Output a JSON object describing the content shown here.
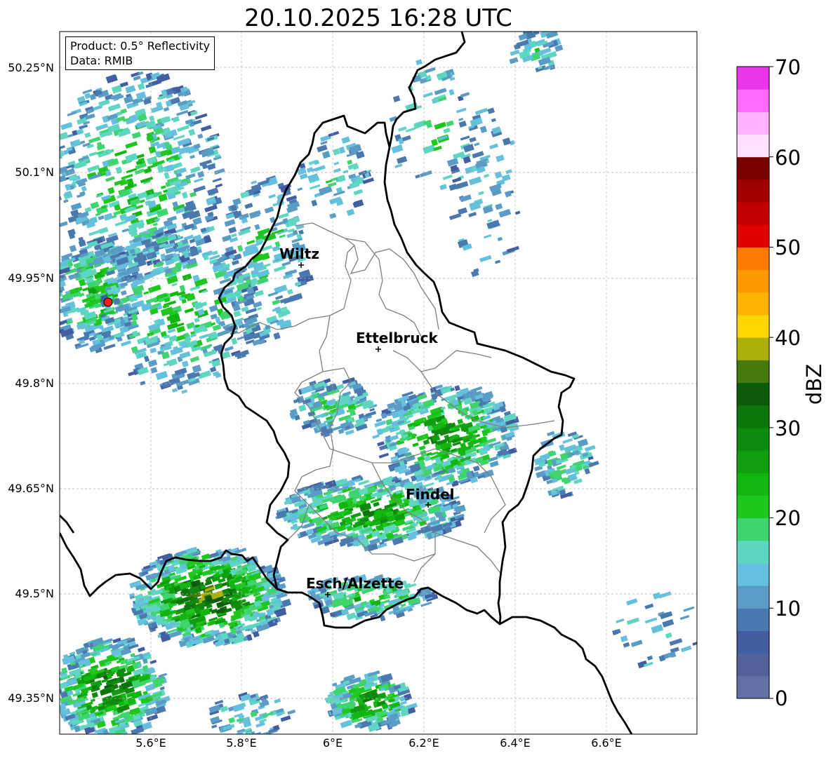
{
  "title": "20.10.2025 16:28 UTC",
  "info": {
    "product_line": "Product: 0.5° Reflectivity",
    "data_line": "Data: RMIB"
  },
  "axes": {
    "lat_labels": [
      "50.25°N",
      "50.1°N",
      "49.95°N",
      "49.8°N",
      "49.65°N",
      "49.5°N",
      "49.35°N"
    ],
    "lon_labels": [
      "5.6°E",
      "5.8°E",
      "6°E",
      "6.2°E",
      "6.4°E",
      "6.6°E"
    ]
  },
  "cities": [
    {
      "name": "Wiltz"
    },
    {
      "name": "Ettelbruck"
    },
    {
      "name": "Findel"
    },
    {
      "name": "Esch/Alzette"
    }
  ],
  "colorbar": {
    "label": "dBZ",
    "ticks": [
      "0",
      "10",
      "20",
      "30",
      "40",
      "50",
      "60",
      "70"
    ],
    "range": [
      0,
      70
    ],
    "step": 2.5,
    "colors": [
      "#6272a4",
      "#52619a",
      "#435da3",
      "#4a79b0",
      "#5a9cc6",
      "#64c0dc",
      "#5fd6c2",
      "#3fd46e",
      "#1dc71d",
      "#12b512",
      "#109e10",
      "#0e8a0e",
      "#0b740b",
      "#0a5c0a",
      "#477a0e",
      "#adb00b",
      "#ffd700",
      "#ffb300",
      "#ff9a00",
      "#ff7b00",
      "#e00000",
      "#c20000",
      "#a00000",
      "#7a0000",
      "#ffe0ff",
      "#ffb3ff",
      "#ff6aff",
      "#ea35ea"
    ]
  },
  "radar_site_color": "#ff1a1a"
}
